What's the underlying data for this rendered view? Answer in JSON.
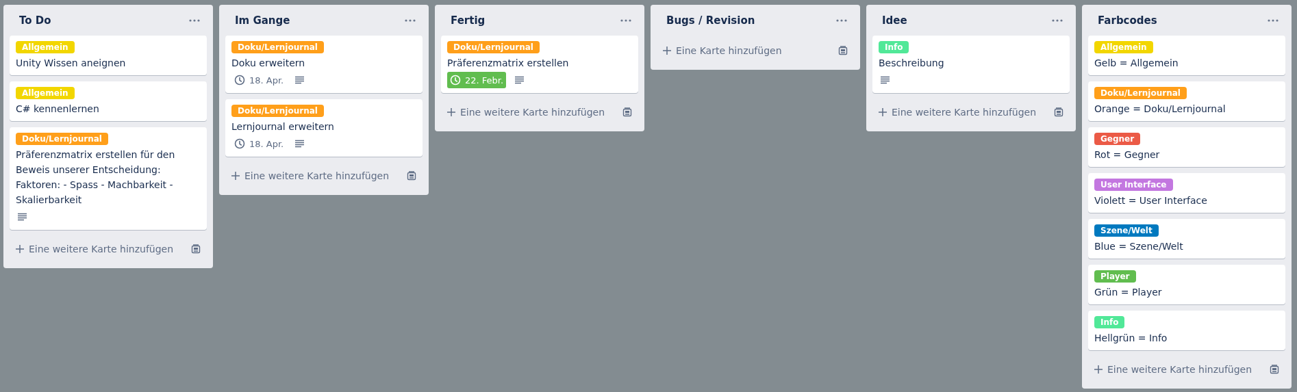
{
  "lists": [
    {
      "title": "To Do",
      "add_label": "Eine weitere Karte hinzufügen",
      "cards": [
        {
          "label": {
            "text": "Allgemein",
            "color": "#f2d600"
          },
          "title": "Unity Wissen aneignen",
          "has_description": false
        },
        {
          "label": {
            "text": "Allgemein",
            "color": "#f2d600"
          },
          "title": "C# kennenlernen",
          "has_description": false
        },
        {
          "label": {
            "text": "Doku/Lernjournal",
            "color": "#ff9f1a"
          },
          "title": "Präferenzmatrix erstellen für den Beweis unserer Entscheidung: Faktoren: - Spass - Machbarkeit - Skalierbarkeit",
          "has_description": true
        }
      ]
    },
    {
      "title": "Im Gange",
      "add_label": "Eine weitere Karte hinzufügen",
      "cards": [
        {
          "label": {
            "text": "Doku/Lernjournal",
            "color": "#ff9f1a"
          },
          "title": "Doku erweitern",
          "due": {
            "text": "18. Apr.",
            "complete": false
          },
          "has_description": true
        },
        {
          "label": {
            "text": "Doku/Lernjournal",
            "color": "#ff9f1a"
          },
          "title": "Lernjournal erweitern",
          "due": {
            "text": "18. Apr.",
            "complete": false
          },
          "has_description": true
        }
      ]
    },
    {
      "title": "Fertig",
      "add_label": "Eine weitere Karte hinzufügen",
      "cards": [
        {
          "label": {
            "text": "Doku/Lernjournal",
            "color": "#ff9f1a"
          },
          "title": "Präferenzmatrix erstellen",
          "due": {
            "text": "22. Febr.",
            "complete": true
          },
          "has_description": true
        }
      ]
    },
    {
      "title": "Bugs / Revision",
      "add_label": "Eine Karte hinzufügen"
    },
    {
      "title": "Idee",
      "add_label": "Eine weitere Karte hinzufügen",
      "cards": [
        {
          "label": {
            "text": "Info",
            "color": "#51e898"
          },
          "title": "Beschreibung",
          "has_description": true
        }
      ]
    },
    {
      "title": "Farbcodes",
      "add_label": "Eine weitere Karte hinzufügen",
      "cards": [
        {
          "label": {
            "text": "Allgemein",
            "color": "#f2d600"
          },
          "title": "Gelb = Allgemein",
          "has_description": false
        },
        {
          "label": {
            "text": "Doku/Lernjournal",
            "color": "#ff9f1a"
          },
          "title": "Orange = Doku/Lernjournal",
          "has_description": false
        },
        {
          "label": {
            "text": "Gegner",
            "color": "#eb5a46"
          },
          "title": "Rot = Gegner",
          "has_description": false
        },
        {
          "label": {
            "text": "User Interface",
            "color": "#c377e0"
          },
          "title": "Violett = User Interface",
          "has_description": false
        },
        {
          "label": {
            "text": "Szene/Welt",
            "color": "#0079bf"
          },
          "title": "Blue = Szene/Welt",
          "has_description": false
        },
        {
          "label": {
            "text": "Player",
            "color": "#61bd4f"
          },
          "title": "Grün = Player",
          "has_description": false
        },
        {
          "label": {
            "text": "Info",
            "color": "#51e898"
          },
          "title": "Hellgrün = Info",
          "has_description": false
        }
      ]
    }
  ]
}
